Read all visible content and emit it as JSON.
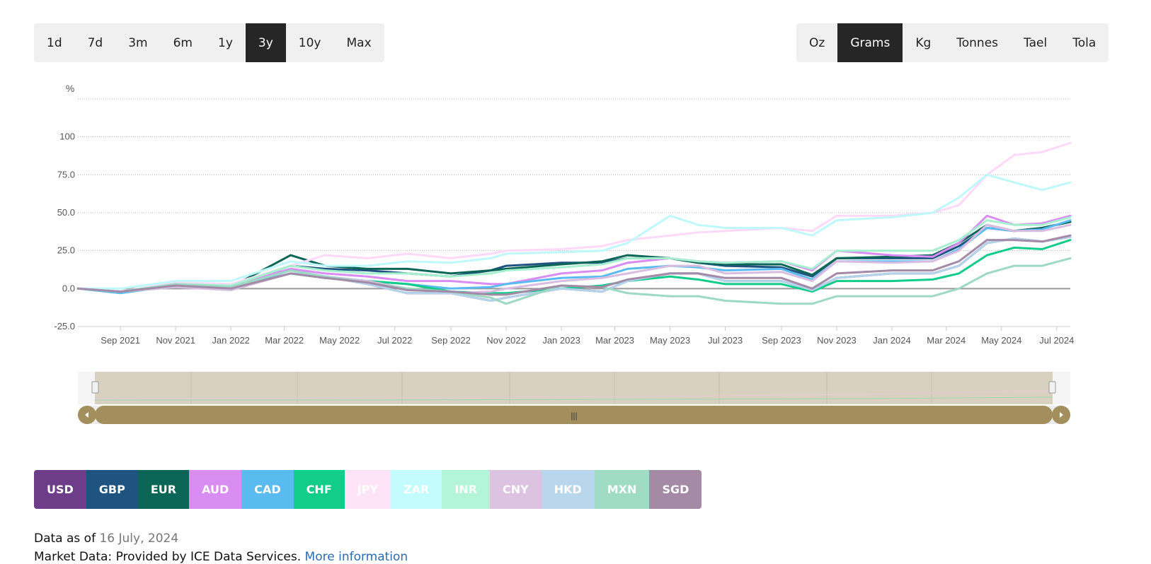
{
  "range_buttons": [
    {
      "label": "1d",
      "active": false
    },
    {
      "label": "7d",
      "active": false
    },
    {
      "label": "3m",
      "active": false
    },
    {
      "label": "6m",
      "active": false
    },
    {
      "label": "1y",
      "active": false
    },
    {
      "label": "3y",
      "active": true
    },
    {
      "label": "10y",
      "active": false
    },
    {
      "label": "Max",
      "active": false
    }
  ],
  "unit_buttons": [
    {
      "label": "Oz",
      "active": false
    },
    {
      "label": "Grams",
      "active": true
    },
    {
      "label": "Kg",
      "active": false
    },
    {
      "label": "Tonnes",
      "active": false
    },
    {
      "label": "Tael",
      "active": false
    },
    {
      "label": "Tola",
      "active": false
    }
  ],
  "chart_data": {
    "type": "line",
    "ylabel": "%",
    "ylim": [
      -25,
      125
    ],
    "yticks": [
      -25,
      0,
      25,
      50,
      75,
      100
    ],
    "ytick_labels": [
      "-25.0",
      "0.0",
      "25.0",
      "50.0",
      "75.0",
      "100"
    ],
    "xlim": [
      "2021-07-16",
      "2024-07-16"
    ],
    "x_ticks": [
      {
        "date": "2021-09-01",
        "label": "Sep 2021"
      },
      {
        "date": "2021-11-01",
        "label": "Nov 2021"
      },
      {
        "date": "2022-01-01",
        "label": "Jan 2022"
      },
      {
        "date": "2022-03-01",
        "label": "Mar 2022"
      },
      {
        "date": "2022-05-01",
        "label": "May 2022"
      },
      {
        "date": "2022-07-01",
        "label": "Jul 2022"
      },
      {
        "date": "2022-09-01",
        "label": "Sep 2022"
      },
      {
        "date": "2022-11-01",
        "label": "Nov 2022"
      },
      {
        "date": "2023-01-01",
        "label": "Jan 2023"
      },
      {
        "date": "2023-03-01",
        "label": "Mar 2023"
      },
      {
        "date": "2023-05-01",
        "label": "May 2023"
      },
      {
        "date": "2023-07-01",
        "label": "Jul 2023"
      },
      {
        "date": "2023-09-01",
        "label": "Sep 2023"
      },
      {
        "date": "2023-11-01",
        "label": "Nov 2023"
      },
      {
        "date": "2024-01-01",
        "label": "Jan 2024"
      },
      {
        "date": "2024-03-01",
        "label": "Mar 2024"
      },
      {
        "date": "2024-05-01",
        "label": "May 2024"
      },
      {
        "date": "2024-07-01",
        "label": "Jul 2024"
      }
    ],
    "x": [
      "2021-07-16",
      "2021-09-01",
      "2021-11-01",
      "2022-01-01",
      "2022-03-08",
      "2022-04-15",
      "2022-06-01",
      "2022-07-15",
      "2022-09-01",
      "2022-10-15",
      "2022-11-01",
      "2023-01-01",
      "2023-02-15",
      "2023-03-15",
      "2023-05-01",
      "2023-06-01",
      "2023-07-01",
      "2023-09-01",
      "2023-10-05",
      "2023-11-01",
      "2024-01-01",
      "2024-02-15",
      "2024-03-15",
      "2024-04-15",
      "2024-05-15",
      "2024-06-15",
      "2024-07-16"
    ],
    "series": [
      {
        "name": "USD",
        "color": "#6e3d8a",
        "values": [
          0,
          -2,
          2,
          0,
          10,
          8,
          3,
          -3,
          -3,
          -8,
          -6,
          0,
          -2,
          5,
          10,
          10,
          5,
          5,
          -1,
          7,
          10,
          10,
          15,
          30,
          33,
          31,
          34
        ]
      },
      {
        "name": "GBP",
        "color": "#1f5480",
        "values": [
          0,
          -2,
          2,
          2,
          15,
          13,
          12,
          10,
          8,
          12,
          15,
          17,
          17,
          20,
          20,
          17,
          15,
          14,
          8,
          20,
          20,
          20,
          28,
          40,
          38,
          40,
          44
        ]
      },
      {
        "name": "EUR",
        "color": "#0b6657",
        "values": [
          0,
          -2,
          2,
          1,
          22,
          15,
          13,
          13,
          10,
          12,
          13,
          16,
          18,
          22,
          20,
          17,
          16,
          16,
          9,
          20,
          21,
          22,
          30,
          42,
          38,
          40,
          44
        ]
      },
      {
        "name": "AUD",
        "color": "#d98cf2",
        "values": [
          0,
          -2,
          3,
          2,
          13,
          10,
          8,
          5,
          5,
          3,
          3,
          10,
          12,
          17,
          20,
          18,
          17,
          18,
          12,
          25,
          22,
          21,
          30,
          48,
          42,
          43,
          48
        ]
      },
      {
        "name": "CAD",
        "color": "#5abbf0",
        "values": [
          0,
          -3,
          2,
          0,
          12,
          8,
          5,
          3,
          0,
          1,
          3,
          7,
          8,
          13,
          15,
          14,
          12,
          13,
          6,
          18,
          18,
          18,
          26,
          40,
          38,
          39,
          45
        ]
      },
      {
        "name": "CHF",
        "color": "#12cc8a",
        "values": [
          0,
          -2,
          1,
          0,
          10,
          7,
          5,
          3,
          -2,
          -3,
          -3,
          0,
          2,
          5,
          8,
          6,
          3,
          3,
          -2,
          5,
          5,
          6,
          10,
          22,
          27,
          26,
          32
        ]
      },
      {
        "name": "JPY",
        "color": "#ffd9f7",
        "values": [
          0,
          -2,
          4,
          3,
          15,
          22,
          20,
          23,
          20,
          23,
          25,
          26,
          28,
          32,
          35,
          37,
          38,
          40,
          38,
          48,
          48,
          50,
          55,
          75,
          88,
          90,
          96
        ]
      },
      {
        "name": "ZAR",
        "color": "#bff8fa",
        "values": [
          0,
          0,
          5,
          5,
          18,
          15,
          15,
          18,
          17,
          20,
          23,
          24,
          25,
          30,
          48,
          42,
          40,
          40,
          35,
          45,
          47,
          50,
          60,
          75,
          70,
          65,
          70
        ]
      },
      {
        "name": "INR",
        "color": "#a6f0d0",
        "values": [
          0,
          -2,
          3,
          2,
          15,
          12,
          10,
          10,
          8,
          10,
          12,
          14,
          16,
          20,
          20,
          18,
          17,
          18,
          13,
          25,
          25,
          25,
          32,
          45,
          42,
          42,
          47
        ]
      },
      {
        "name": "CNY",
        "color": "#d8bde0",
        "values": [
          0,
          -2,
          1,
          -1,
          10,
          8,
          5,
          0,
          -3,
          -2,
          0,
          5,
          7,
          10,
          15,
          15,
          10,
          11,
          5,
          18,
          17,
          18,
          25,
          42,
          38,
          38,
          42
        ]
      },
      {
        "name": "HKD",
        "color": "#b3d4ea",
        "values": [
          0,
          -2,
          2,
          0,
          10,
          8,
          3,
          -3,
          -3,
          -8,
          -6,
          0,
          -2,
          5,
          10,
          10,
          5,
          5,
          -1,
          7,
          10,
          10,
          15,
          30,
          33,
          31,
          34
        ]
      },
      {
        "name": "MXN",
        "color": "#9dd9c5",
        "values": [
          0,
          -2,
          3,
          1,
          12,
          8,
          4,
          0,
          -2,
          -6,
          -10,
          2,
          1,
          -3,
          -5,
          -5,
          -8,
          -10,
          -10,
          -5,
          -5,
          -5,
          0,
          10,
          15,
          15,
          20
        ]
      },
      {
        "name": "SGD",
        "color": "#a38aa6",
        "values": [
          0,
          -2,
          2,
          0,
          10,
          7,
          4,
          -1,
          -2,
          -4,
          -4,
          2,
          1,
          6,
          10,
          10,
          7,
          7,
          0,
          10,
          12,
          12,
          18,
          32,
          32,
          31,
          35
        ]
      }
    ]
  },
  "currencies": [
    {
      "label": "USD",
      "color": "#6e3d8a",
      "text_color": "#ffffff"
    },
    {
      "label": "GBP",
      "color": "#1f5480",
      "text_color": "#ffffff"
    },
    {
      "label": "EUR",
      "color": "#0b6657",
      "text_color": "#ffffff"
    },
    {
      "label": "AUD",
      "color": "#d98cf2",
      "text_color": "#ffffff"
    },
    {
      "label": "CAD",
      "color": "#5abbf0",
      "text_color": "#ffffff"
    },
    {
      "label": "CHF",
      "color": "#12cc8a",
      "text_color": "#ffffff"
    },
    {
      "label": "JPY",
      "color": "#ffe4f8",
      "text_color": "#ffffff"
    },
    {
      "label": "ZAR",
      "color": "#c4fbfc",
      "text_color": "#ffffff"
    },
    {
      "label": "INR",
      "color": "#b3f5d8",
      "text_color": "#ffffff"
    },
    {
      "label": "CNY",
      "color": "#dcc3e2",
      "text_color": "#ffffff"
    },
    {
      "label": "HKD",
      "color": "#b8d6ec",
      "text_color": "#ffffff"
    },
    {
      "label": "MXN",
      "color": "#a0dbc6",
      "text_color": "#ffffff"
    },
    {
      "label": "SGD",
      "color": "#a48aa5",
      "text_color": "#ffffff"
    }
  ],
  "footer": {
    "data_as_of_label": "Data as of",
    "data_as_of_date": "16 July, 2024",
    "market_data_label": "Market Data: Provided by ICE Data Services.",
    "more_info_link": "More information"
  },
  "navigator": {
    "handle_glyph": "|||"
  },
  "colors": {
    "active_button": "#262626",
    "navigator_bg": "#d8d1bf",
    "scrollbar": "#a38e5d"
  }
}
